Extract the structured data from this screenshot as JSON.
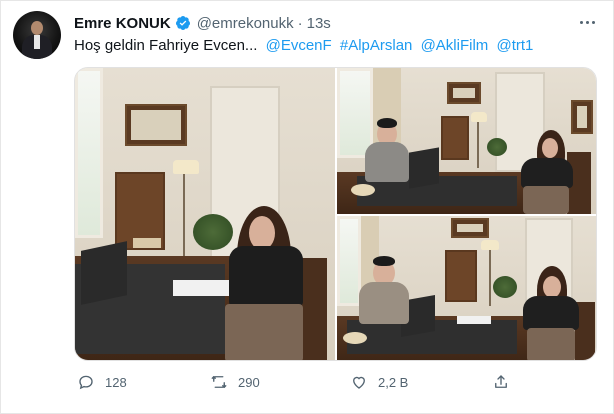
{
  "tweet": {
    "author_name": "Emre KONUK",
    "handle": "@emrekonukk",
    "separator": "·",
    "time": "13s",
    "text_main": "Hoş geldin Fahriye Evcen...",
    "links": [
      "@EvcenF",
      "#AlpArslan",
      "@AkliFilm",
      "@trt1"
    ]
  },
  "icons": {
    "verified": "verified-badge-icon",
    "more": "more-options-icon",
    "reply": "reply-icon",
    "retweet": "retweet-icon",
    "like": "like-icon",
    "share": "share-icon"
  },
  "actions": {
    "replies": "128",
    "retweets": "290",
    "likes": "2,2 B"
  },
  "colors": {
    "link": "#1d9bf0",
    "secondary_text": "#536471",
    "verified": "#1d9bf0"
  }
}
